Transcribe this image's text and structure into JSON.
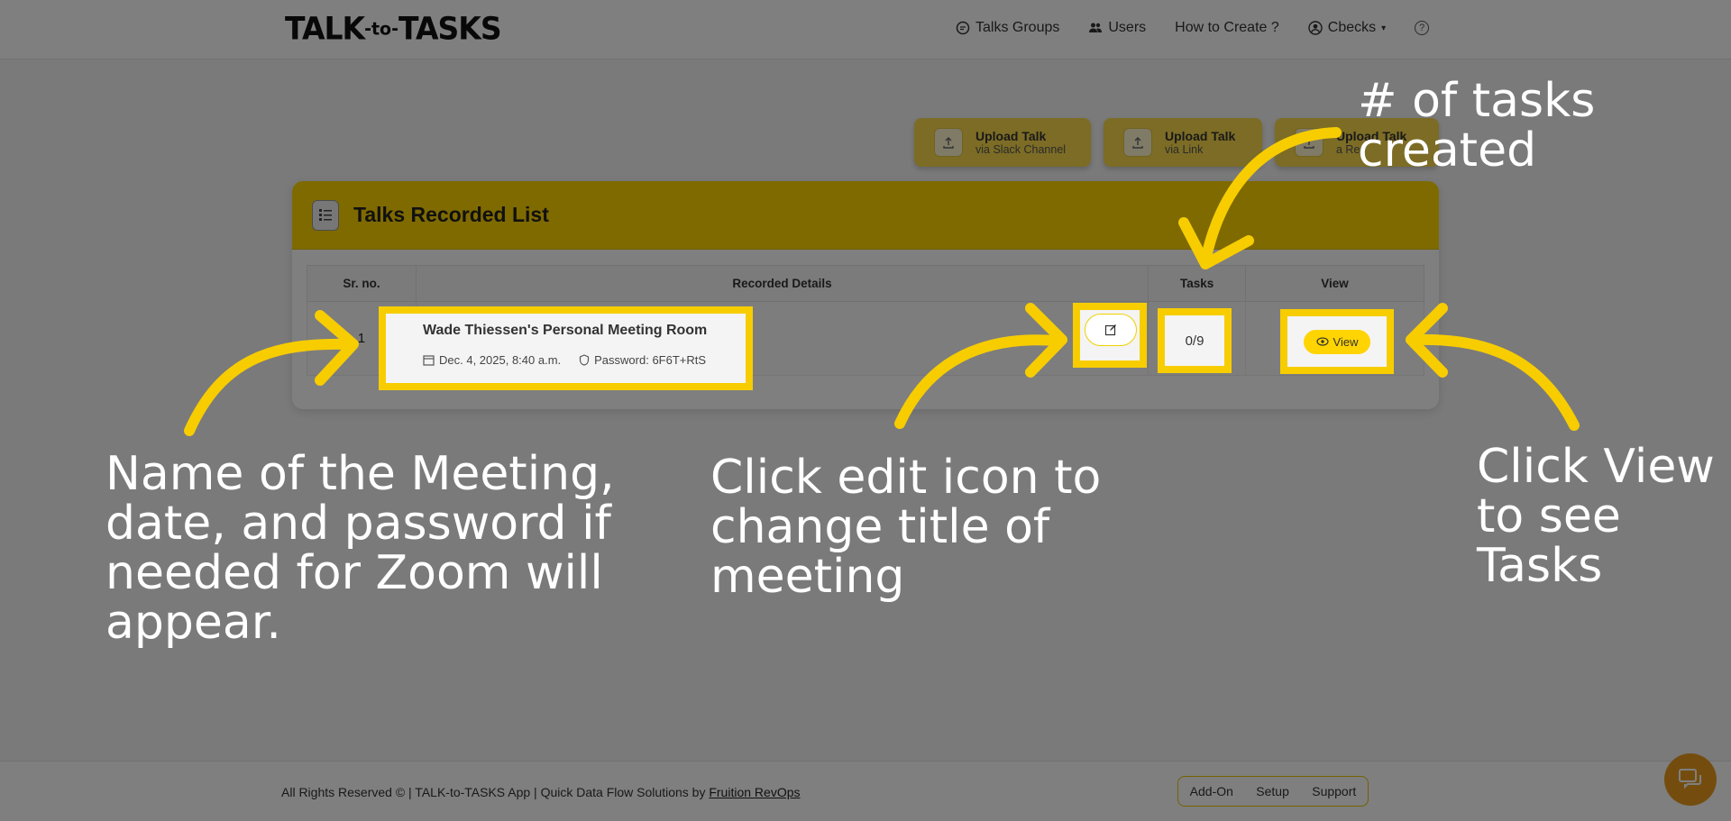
{
  "header": {
    "logo_left": "TALK",
    "logo_mid": "-to-",
    "logo_right": "TASKS",
    "nav": {
      "talks_groups": "Talks Groups",
      "users": "Users",
      "how_to_create": "How to Create ?",
      "account": "Cbecks",
      "help": "?"
    }
  },
  "uploads": [
    {
      "title": "Upload Talk",
      "sub": "via Slack Channel"
    },
    {
      "title": "Upload Talk",
      "sub": "via Link"
    },
    {
      "title": "Upload Talk",
      "sub": "a Rec"
    }
  ],
  "card": {
    "title": "Talks Recorded List",
    "columns": {
      "sr": "Sr. no.",
      "details": "Recorded Details",
      "tasks": "Tasks",
      "view": "View"
    },
    "rows": [
      {
        "sr": "1",
        "name": "Wade Thiessen's Personal Meeting Room",
        "date": "Dec. 4, 2025, 8:40 a.m.",
        "password": "Password: 6F6T+RtS",
        "tasks": "0/9",
        "view_label": "View"
      }
    ]
  },
  "footer": {
    "text": "All Rights Reserved © | TALK-to-TASKS App | Quick Data Flow Solutions by ",
    "link": "Fruition RevOps",
    "links": {
      "addon": "Add-On",
      "setup": "Setup",
      "support": "Support"
    }
  },
  "annotations": {
    "tasks_count_l1": "# of tasks",
    "tasks_count_l2": "created",
    "meeting_l1": "Name of the Meeting,",
    "meeting_l2": "date, and password if",
    "meeting_l3": "needed for Zoom will",
    "meeting_l4": "appear.",
    "edit_l1": "Click edit icon to",
    "edit_l2": "change title of",
    "edit_l3": "meeting",
    "view_l1": "Click View",
    "view_l2": "to see",
    "view_l3": "Tasks"
  },
  "colors": {
    "accent": "#ffd400",
    "highlight": "#f7cd00",
    "chat": "#e99a1c"
  }
}
